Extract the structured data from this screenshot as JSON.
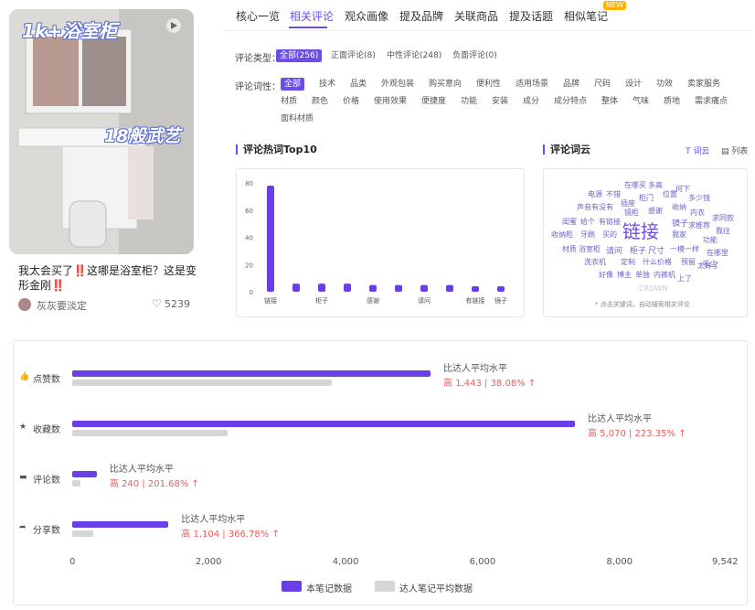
{
  "note": {
    "overlay_top": "1k+浴室柜",
    "overlay_mid": "18般武艺",
    "title": "我太会买了‼️这哪是浴室柜？这是变形金刚‼️",
    "author": "灰灰要淡定",
    "likes": "5239"
  },
  "tabs": [
    "核心一览",
    "相关评论",
    "观众画像",
    "提及品牌",
    "关联商品",
    "提及话题",
    "相似笔记"
  ],
  "new_badge": "NEW",
  "filters": {
    "type_label": "评论类型：",
    "types": [
      "全部(256)",
      "正面评论(8)",
      "中性评论(248)",
      "负面评论(0)"
    ],
    "words_label": "评论词性：",
    "words_row1": [
      "全部",
      "技术",
      "品类",
      "外观包装",
      "购买意向",
      "便利性",
      "适用场景",
      "品牌",
      "尺码",
      "设计",
      "功效",
      "卖家服务"
    ],
    "words_row2": [
      "材质",
      "颜色",
      "价格",
      "使用效果",
      "便捷度",
      "功能",
      "安装",
      "成分",
      "成分特点",
      "整体",
      "气味",
      "质地",
      "需求痛点"
    ],
    "words_row3": [
      "面料材质"
    ]
  },
  "hotwords": {
    "title": "评论热词Top10"
  },
  "wordcloud": {
    "title": "评论词云",
    "toggle_cloud": "词云",
    "toggle_list": "列表",
    "note": "* 点击关键词，自动搜索相关评论",
    "words": [
      {
        "t": "链接",
        "s": 20,
        "c": "#6a4fd8"
      },
      {
        "t": "在哪买",
        "s": 8
      },
      {
        "t": "多高",
        "s": 8
      },
      {
        "t": "何下",
        "s": 8
      },
      {
        "t": "电源",
        "s": 8
      },
      {
        "t": "不错",
        "s": 8
      },
      {
        "t": "柜门",
        "s": 8
      },
      {
        "t": "位置",
        "s": 8
      },
      {
        "t": "多少钱",
        "s": 8
      },
      {
        "t": "插座",
        "s": 8
      },
      {
        "t": "声音",
        "s": 8
      },
      {
        "t": "有没有",
        "s": 8
      },
      {
        "t": "镜柜",
        "s": 8
      },
      {
        "t": "感谢",
        "s": 8
      },
      {
        "t": "收纳",
        "s": 8
      },
      {
        "t": "内衣",
        "s": 8
      },
      {
        "t": "求同款",
        "s": 8
      },
      {
        "t": "闺蜜",
        "s": 8
      },
      {
        "t": "给个",
        "s": 8
      },
      {
        "t": "有链接",
        "s": 8
      },
      {
        "t": "镜子",
        "s": 9
      },
      {
        "t": "求推荐",
        "s": 8
      },
      {
        "t": "我往",
        "s": 8
      },
      {
        "t": "收纳柜",
        "s": 8
      },
      {
        "t": "牙刷",
        "s": 8
      },
      {
        "t": "买的",
        "s": 8
      },
      {
        "t": "我家",
        "s": 8
      },
      {
        "t": "功能",
        "s": 8
      },
      {
        "t": "材质",
        "s": 8
      },
      {
        "t": "浴室柜",
        "s": 8
      },
      {
        "t": "请问",
        "s": 9
      },
      {
        "t": "柜子",
        "s": 9
      },
      {
        "t": "尺寸",
        "s": 9
      },
      {
        "t": "一模一样",
        "s": 8
      },
      {
        "t": "在哪里",
        "s": 8
      },
      {
        "t": "吸尘",
        "s": 8
      },
      {
        "t": "洗衣机",
        "s": 8
      },
      {
        "t": "定制",
        "s": 8
      },
      {
        "t": "什么价格",
        "s": 8
      },
      {
        "t": "预留",
        "s": 8
      },
      {
        "t": "太好了",
        "s": 8
      },
      {
        "t": "好像",
        "s": 8
      },
      {
        "t": "博主",
        "s": 8
      },
      {
        "t": "单独",
        "s": 8
      },
      {
        "t": "内裤机",
        "s": 8
      },
      {
        "t": "上了",
        "s": 8
      },
      {
        "t": "CROWN",
        "s": 8
      }
    ]
  },
  "compare": {
    "rows": [
      {
        "label": "点赞数",
        "icon": "thumb-up-icon",
        "ref_label": "比达人平均水平",
        "ref_value": "高 1,443 | 38.08% ↑"
      },
      {
        "label": "收藏数",
        "icon": "star-icon",
        "ref_label": "比达人平均水平",
        "ref_value": "高 5,070 | 223.35% ↑"
      },
      {
        "label": "评论数",
        "icon": "comment-icon",
        "ref_label": "比达人平均水平",
        "ref_value": "高 240 | 201.68% ↑"
      },
      {
        "label": "分享数",
        "icon": "share-icon",
        "ref_label": "比达人平均水平",
        "ref_value": "高 1,104 | 366.78% ↑"
      }
    ],
    "legend": [
      "本笔记数据",
      "达人笔记平均数据"
    ]
  },
  "colors": {
    "accent": "#6c4ee6",
    "bar_main": "#6b3fe8",
    "bar_avg": "#d6d6d6",
    "up": "#f05a5a"
  },
  "chart_data": [
    {
      "type": "bar",
      "title": "评论热词Top10",
      "categories": [
        "链接",
        "",
        "柜子",
        "",
        "感谢",
        "",
        "请问",
        "",
        "有链接",
        "镜子"
      ],
      "values": [
        78,
        6,
        6,
        6,
        5,
        5,
        5,
        5,
        4,
        4
      ],
      "ylim": [
        0,
        80
      ],
      "yticks": [
        0,
        20,
        40,
        60,
        80
      ]
    },
    {
      "type": "bar",
      "orientation": "horizontal",
      "categories": [
        "点赞数",
        "收藏数",
        "评论数",
        "分享数"
      ],
      "series": [
        {
          "name": "本笔记数据",
          "values": [
            5232,
            7340,
            359,
            1405
          ]
        },
        {
          "name": "达人笔记平均数据",
          "values": [
            3789,
            2270,
            119,
            301
          ]
        }
      ],
      "xlim": [
        0,
        9542
      ],
      "xticks": [
        "0",
        "2,000",
        "4,000",
        "6,000",
        "8,000",
        "9,542"
      ]
    }
  ]
}
